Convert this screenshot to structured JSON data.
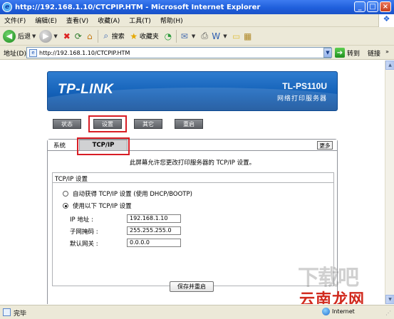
{
  "window": {
    "title": "http://192.168.1.10/CTCPIP.HTM - Microsoft Internet Explorer",
    "minimize": "_",
    "maximize": "□",
    "close": "×"
  },
  "menu": {
    "items": [
      "文件(F)",
      "编辑(E)",
      "查看(V)",
      "收藏(A)",
      "工具(T)",
      "帮助(H)"
    ]
  },
  "toolbar": {
    "back_label": "后退",
    "search_label": "搜索",
    "favorites_label": "收藏夹"
  },
  "address": {
    "label": "地址(D)",
    "url": "http://192.168.1.10/CTCPIP.HTM",
    "go_label": "转到",
    "links_label": "链接"
  },
  "banner": {
    "logo": "TP-LINK",
    "model": "TL-PS110U",
    "subtitle": "网络打印服务器"
  },
  "nav": {
    "status": "状态",
    "settings": "设置",
    "other": "其它",
    "restart": "重启",
    "active": "settings"
  },
  "tabs": {
    "system": "系统",
    "tcpip": "TCP/IP",
    "more": "更多",
    "active": "tcpip"
  },
  "content": {
    "description": "此屏幕允许您更改打印服务器的 TCP/IP 设置。",
    "group_title": "TCP/IP 设置",
    "radio_auto": "自动获得 TCP/IP 设置 (使用 DHCP/BOOTP)",
    "radio_manual": "使用以下 TCP/IP 设置",
    "selected_mode": "manual",
    "fields": {
      "ip_label": "IP 地址 :",
      "ip_value": "192.168.1.10",
      "mask_label": "子网掩码 :",
      "mask_value": "255.255.255.0",
      "gateway_label": "默认网关 :",
      "gateway_value": "0.0.0.0"
    },
    "save_button": "保存并重启"
  },
  "watermark": {
    "top": "下载吧",
    "bottom": "云南龙网"
  },
  "status": {
    "text": "完毕",
    "zone": "Internet"
  },
  "colors": {
    "title_bar": "#1f5fdc",
    "banner_blue": "#1461b8",
    "highlight_red": "#d81d25",
    "nav_button": "#6e7176",
    "tab_active": "#d0d1d3"
  }
}
